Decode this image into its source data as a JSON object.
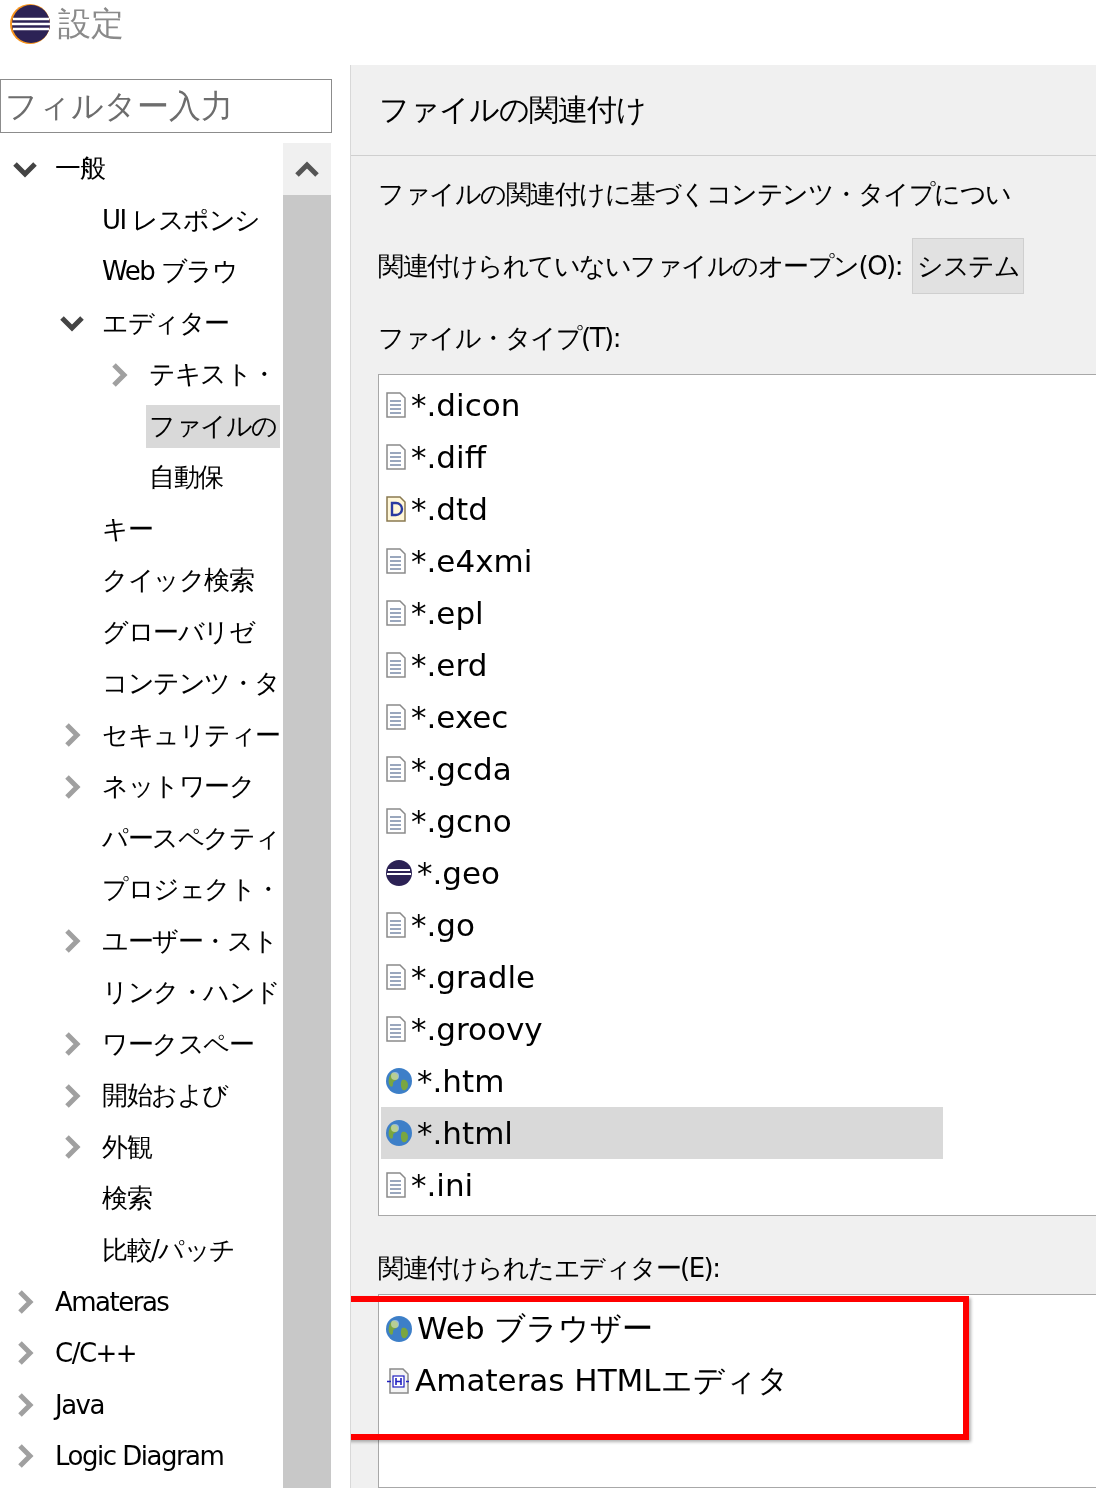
{
  "window": {
    "title": "設定"
  },
  "filter": {
    "placeholder": "フィルター入力"
  },
  "tree": [
    {
      "label": "一般",
      "selected": false,
      "expanded": true,
      "children": [
        {
          "label": "UI レスポンシ",
          "selected": false
        },
        {
          "label": "Web ブラウ",
          "selected": false
        },
        {
          "label": "エディター",
          "selected": false,
          "expanded": true,
          "children": [
            {
              "label": "テキスト・",
              "selected": false,
              "expanded": false
            },
            {
              "label": "ファイルの",
              "selected": true
            },
            {
              "label": "自動保",
              "selected": false
            }
          ]
        },
        {
          "label": "キー",
          "selected": false
        },
        {
          "label": "クイック検索",
          "selected": false
        },
        {
          "label": "グローバリゼ",
          "selected": false
        },
        {
          "label": "コンテンツ・タ",
          "selected": false
        },
        {
          "label": "セキュリティー",
          "selected": false,
          "expanded": false
        },
        {
          "label": "ネットワーク",
          "selected": false,
          "expanded": false
        },
        {
          "label": "パースペクティ",
          "selected": false
        },
        {
          "label": "プロジェクト・",
          "selected": false
        },
        {
          "label": "ユーザー・スト",
          "selected": false,
          "expanded": false
        },
        {
          "label": "リンク・ハンド",
          "selected": false
        },
        {
          "label": "ワークスペー",
          "selected": false,
          "expanded": false
        },
        {
          "label": "開始および",
          "selected": false,
          "expanded": false
        },
        {
          "label": "外観",
          "selected": false,
          "expanded": false
        },
        {
          "label": "検索",
          "selected": false
        },
        {
          "label": "比較/パッチ",
          "selected": false
        }
      ]
    },
    {
      "label": "Amateras",
      "selected": false,
      "expanded": false
    },
    {
      "label": "C/C++",
      "selected": false,
      "expanded": false
    },
    {
      "label": "Java",
      "selected": false,
      "expanded": false
    },
    {
      "label": "Logic Diagram",
      "selected": false,
      "expanded": false
    }
  ],
  "page": {
    "title": "ファイルの関連付け",
    "description": "ファイルの関連付けに基づくコンテンツ・タイプについ",
    "open_unassociated": {
      "label": "関連付けられていないファイルのオープン(O):",
      "value": "システム"
    },
    "file_types_label": "ファイル・タイプ(T):",
    "file_types": [
      {
        "name": "*.dicon",
        "kind": "document",
        "selected": false
      },
      {
        "name": "*.diff",
        "kind": "document",
        "selected": false
      },
      {
        "name": "*.dtd",
        "kind": "dtd",
        "selected": false
      },
      {
        "name": "*.e4xmi",
        "kind": "document",
        "selected": false
      },
      {
        "name": "*.epl",
        "kind": "document",
        "selected": false
      },
      {
        "name": "*.erd",
        "kind": "document",
        "selected": false
      },
      {
        "name": "*.exec",
        "kind": "document",
        "selected": false
      },
      {
        "name": "*.gcda",
        "kind": "document",
        "selected": false
      },
      {
        "name": "*.gcno",
        "kind": "document",
        "selected": false
      },
      {
        "name": "*.geo",
        "kind": "eclipse",
        "selected": false
      },
      {
        "name": "*.go",
        "kind": "document",
        "selected": false
      },
      {
        "name": "*.gradle",
        "kind": "document",
        "selected": false
      },
      {
        "name": "*.groovy",
        "kind": "document",
        "selected": false
      },
      {
        "name": "*.htm",
        "kind": "globe",
        "selected": false
      },
      {
        "name": "*.html",
        "kind": "globe",
        "selected": true
      },
      {
        "name": "*.ini",
        "kind": "document",
        "selected": false
      }
    ],
    "editors_label": "関連付けられたエディター(E):",
    "editors_highlighted": true,
    "editors": [
      {
        "name": "Web ブラウザー",
        "kind": "globe"
      },
      {
        "name": "Amateras HTMLエディタ",
        "kind": "html"
      }
    ]
  }
}
